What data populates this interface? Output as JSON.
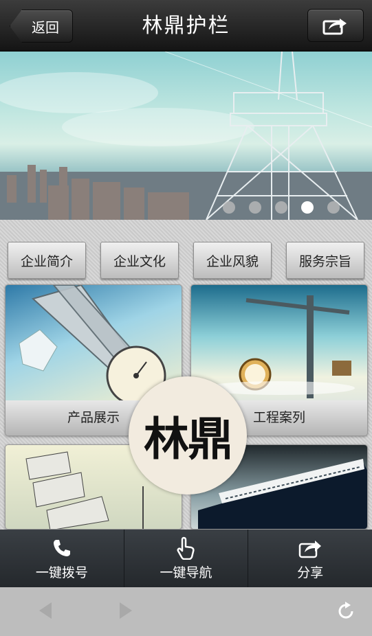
{
  "header": {
    "back_label": "返回",
    "title": "林鼎护栏",
    "share_icon": "share-icon"
  },
  "banner": {
    "slide_count": 5,
    "active_slide": 4
  },
  "menu": [
    {
      "label": "企业简介"
    },
    {
      "label": "企业文化"
    },
    {
      "label": "企业风貌"
    },
    {
      "label": "服务宗旨"
    }
  ],
  "tiles": [
    {
      "label": "产品展示"
    },
    {
      "label": "工程案列"
    },
    {
      "label": ""
    },
    {
      "label": ""
    }
  ],
  "logo_text": "林鼎",
  "actions": [
    {
      "label": "一键拨号",
      "icon": "phone-icon"
    },
    {
      "label": "一键导航",
      "icon": "hand-pointer-icon"
    },
    {
      "label": "分享",
      "icon": "share-icon"
    }
  ],
  "browser": {
    "icons": [
      "back-arrow-icon",
      "forward-arrow-icon",
      "refresh-icon"
    ]
  }
}
